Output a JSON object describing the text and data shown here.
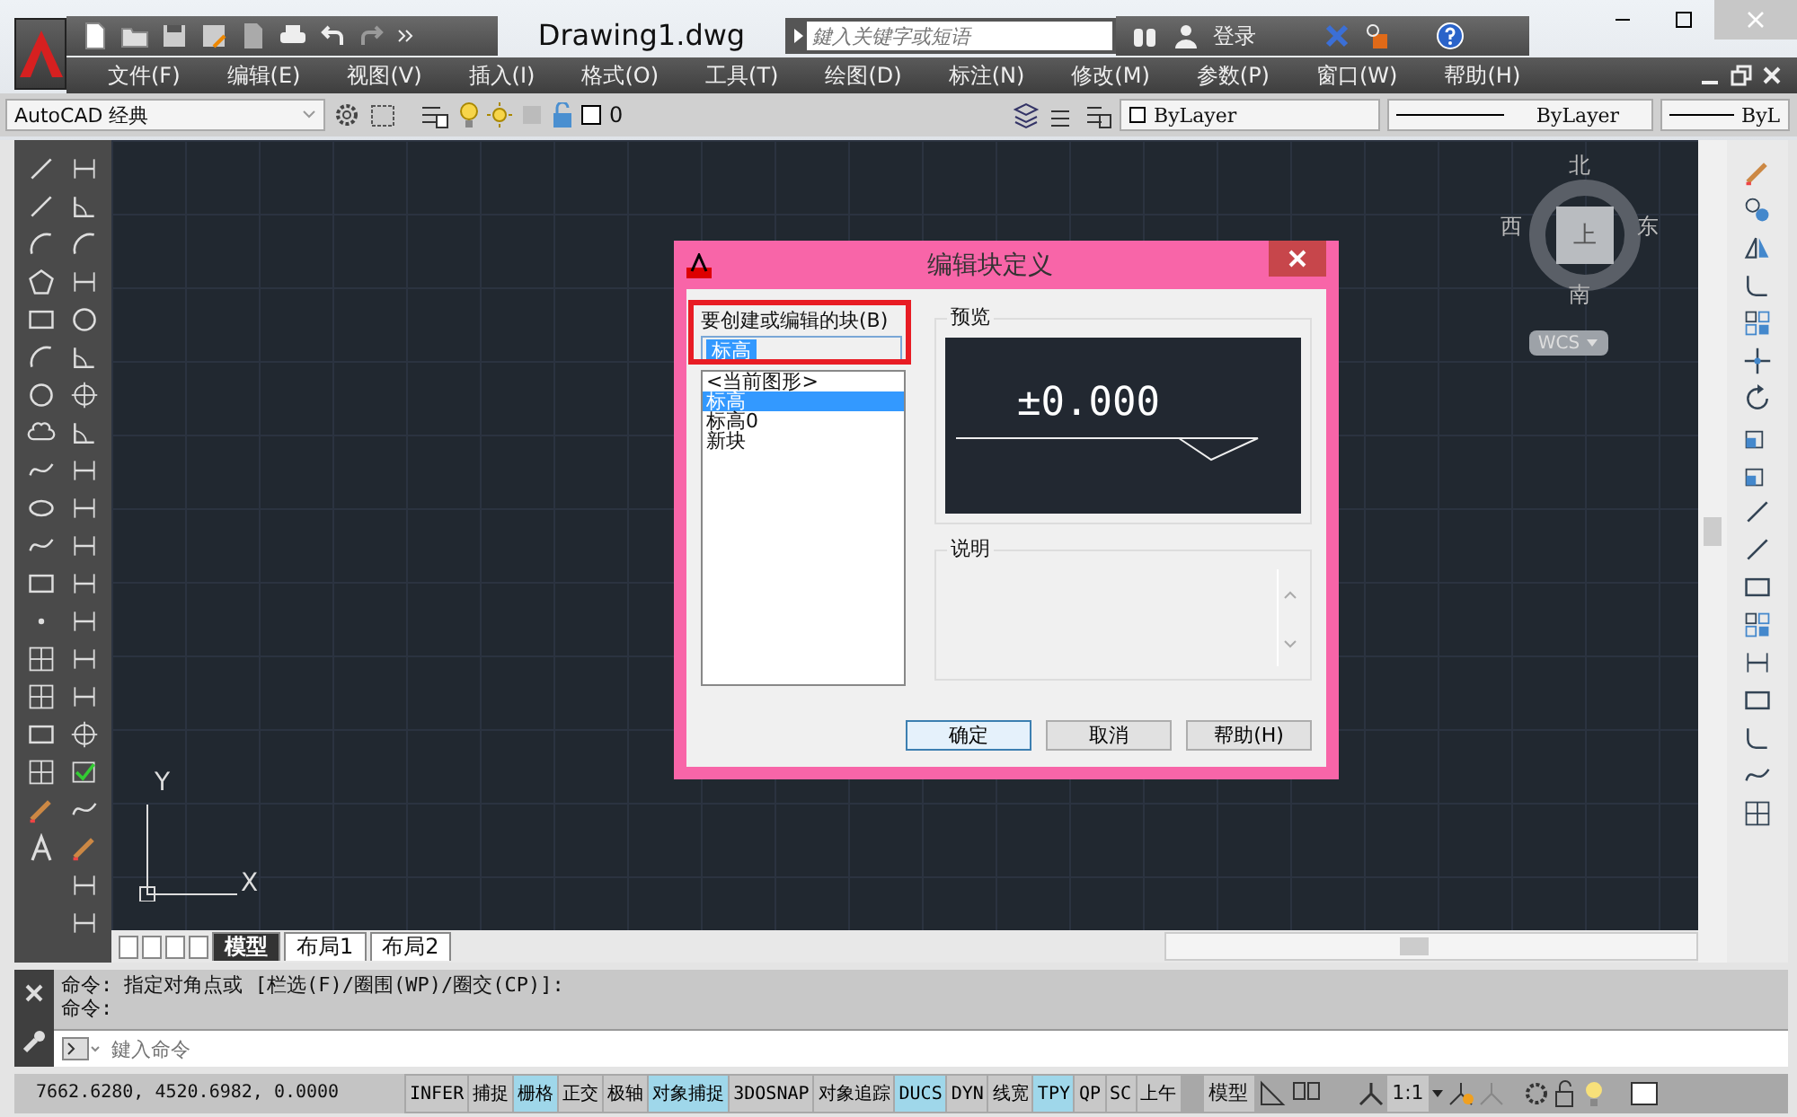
{
  "title_bar": {
    "title": "Drawing1.dwg",
    "search": {
      "placeholder": "鍵入关键字或短语"
    },
    "login": "登录"
  },
  "menu": [
    "文件(F)",
    "编辑(E)",
    "视图(V)",
    "插入(I)",
    "格式(O)",
    "工具(T)",
    "绘图(D)",
    "标注(N)",
    "修改(M)",
    "参数(P)",
    "窗口(W)",
    "帮助(H)"
  ],
  "toolbar": {
    "workspace": "AutoCAD 经典",
    "layer": "0",
    "color_setting": "ByLayer",
    "linetype": "ByLayer",
    "lineweight": "ByL"
  },
  "viewcube": {
    "north": "北",
    "west": "西",
    "east": "东",
    "south": "南",
    "face": "上",
    "ucs_menu": "WCS"
  },
  "ucs_icon": {
    "x_label": "X",
    "y_label": "Y"
  },
  "dialog": {
    "title": "编辑块定义",
    "block_label": "要创建或编辑的块(B)",
    "block_value": "标高",
    "blocks": [
      {
        "label": "<当前图形>",
        "selected": false
      },
      {
        "label": "标高",
        "selected": true
      },
      {
        "label": "标高0",
        "selected": false
      },
      {
        "label": "新块",
        "selected": false
      }
    ],
    "preview_label": "预览",
    "preview_text": "±0.000",
    "description_label": "说明",
    "buttons": [
      {
        "label": "确定",
        "default": true
      },
      {
        "label": "取消",
        "default": false
      },
      {
        "label": "帮助(H)",
        "default": false
      }
    ]
  },
  "layout_tabs": [
    {
      "label": "模型",
      "selected": true
    },
    {
      "label": "布局1",
      "selected": false
    },
    {
      "label": "布局2",
      "selected": false
    }
  ],
  "command": {
    "history": [
      "命令: 指定对角点或 [栏选(F)/圈围(WP)/圈交(CP)]:",
      "命令:"
    ],
    "placeholder": "鍵入命令"
  },
  "status_bar": {
    "coordinates": "7662.6280,  4520.6982, 0.0000",
    "toggles": [
      {
        "label": "INFER",
        "on": false
      },
      {
        "label": "捕捉",
        "on": false
      },
      {
        "label": "栅格",
        "on": true
      },
      {
        "label": "正交",
        "on": false
      },
      {
        "label": "极轴",
        "on": false
      },
      {
        "label": "对象捕捉",
        "on": true
      },
      {
        "label": "3DOSNAP",
        "on": false
      },
      {
        "label": "对象追踪",
        "on": false
      },
      {
        "label": "DUCS",
        "on": true
      },
      {
        "label": "DYN",
        "on": false
      },
      {
        "label": "线宽",
        "on": false
      },
      {
        "label": "TPY",
        "on": true
      },
      {
        "label": "QP",
        "on": false
      },
      {
        "label": "SC",
        "on": false
      },
      {
        "label": "上午",
        "on": false
      }
    ],
    "space": "模型",
    "scale": "1:1"
  }
}
